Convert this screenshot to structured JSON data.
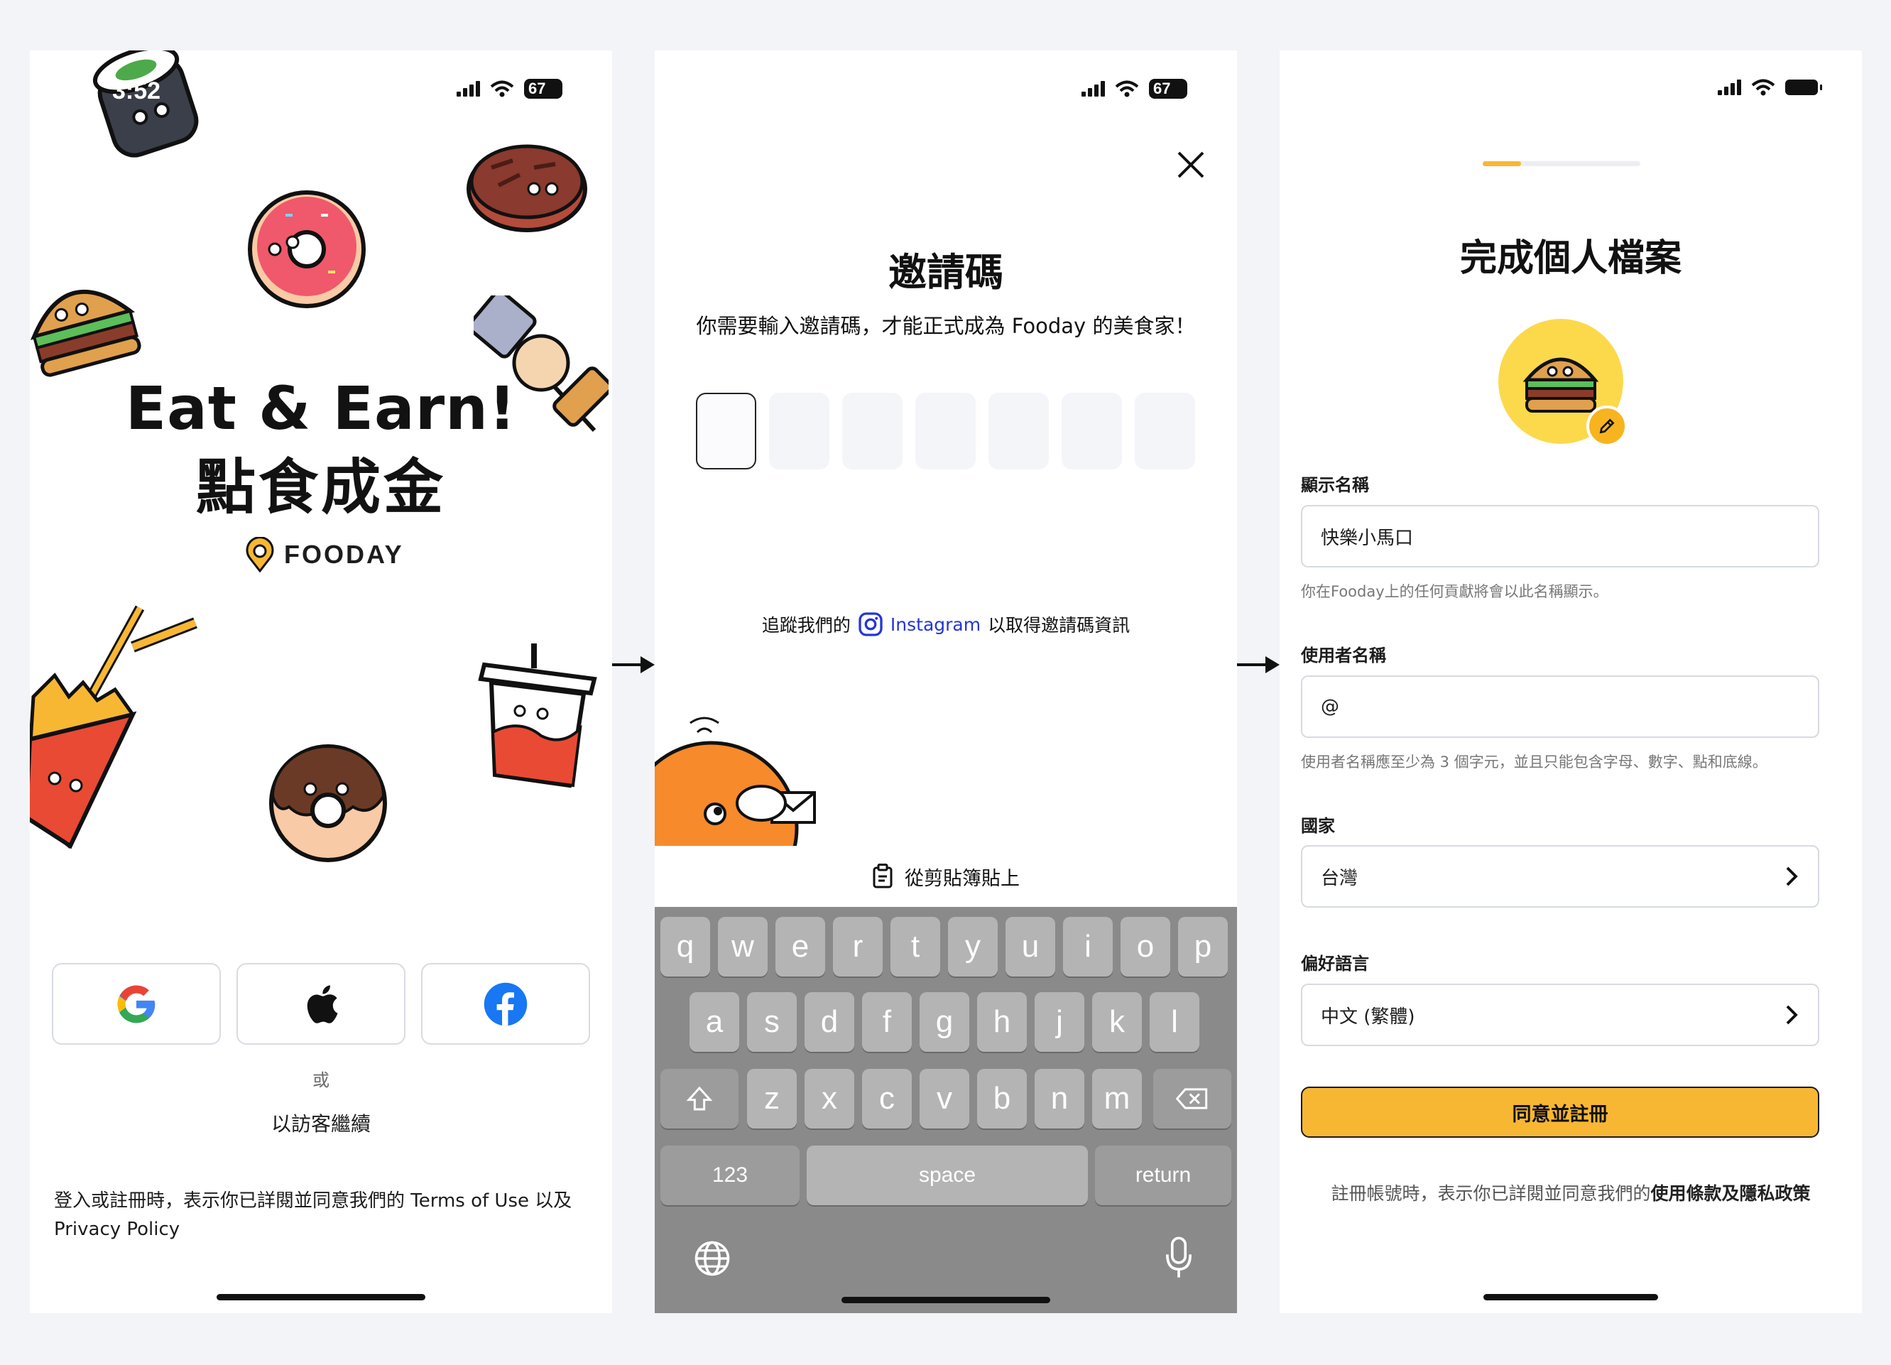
{
  "status": {
    "time": "3:52",
    "battery": "67"
  },
  "screen1": {
    "title": "Eat & Earn!",
    "subtitle": "點食成金",
    "brand": "FOODAY",
    "social": [
      "google-icon",
      "apple-icon",
      "facebook-icon"
    ],
    "or": "或",
    "guest": "以訪客繼續",
    "legal": "登入或註冊時，表示你已詳閱並同意我們的 Terms of Use 以及 Privacy Policy"
  },
  "screen2": {
    "title": "邀請碼",
    "description": "你需要輸入邀請碼，才能正式成為 Fooday 的美食家！",
    "follow_prefix": "追蹤我們的",
    "follow_link": "Instagram",
    "follow_suffix": "以取得邀請碼資訊",
    "paste": "從剪貼簿貼上",
    "keyboard": {
      "row1": [
        "q",
        "w",
        "e",
        "r",
        "t",
        "y",
        "u",
        "i",
        "o",
        "p"
      ],
      "row2": [
        "a",
        "s",
        "d",
        "f",
        "g",
        "h",
        "j",
        "k",
        "l"
      ],
      "row3": [
        "z",
        "x",
        "c",
        "v",
        "b",
        "n",
        "m"
      ],
      "numbers": "123",
      "space": "space",
      "return": "return"
    }
  },
  "screen3": {
    "title": "完成個人檔案",
    "display_name_label": "顯示名稱",
    "display_name_value": "快樂小馬口",
    "display_name_hint": "你在Fooday上的任何貢獻將會以此名稱顯示。",
    "username_label": "使用者名稱",
    "username_value": "@",
    "username_hint": "使用者名稱應至少為 3 個字元，並且只能包含字母、數字、點和底線。",
    "country_label": "國家",
    "country_value": "台灣",
    "language_label": "偏好語言",
    "language_value": "中文 (繁體)",
    "submit": "同意並註冊",
    "terms_prefix": "註冊帳號時，表示你已詳閱並同意我們的",
    "terms_bold": "使用條款及隱私政策"
  }
}
